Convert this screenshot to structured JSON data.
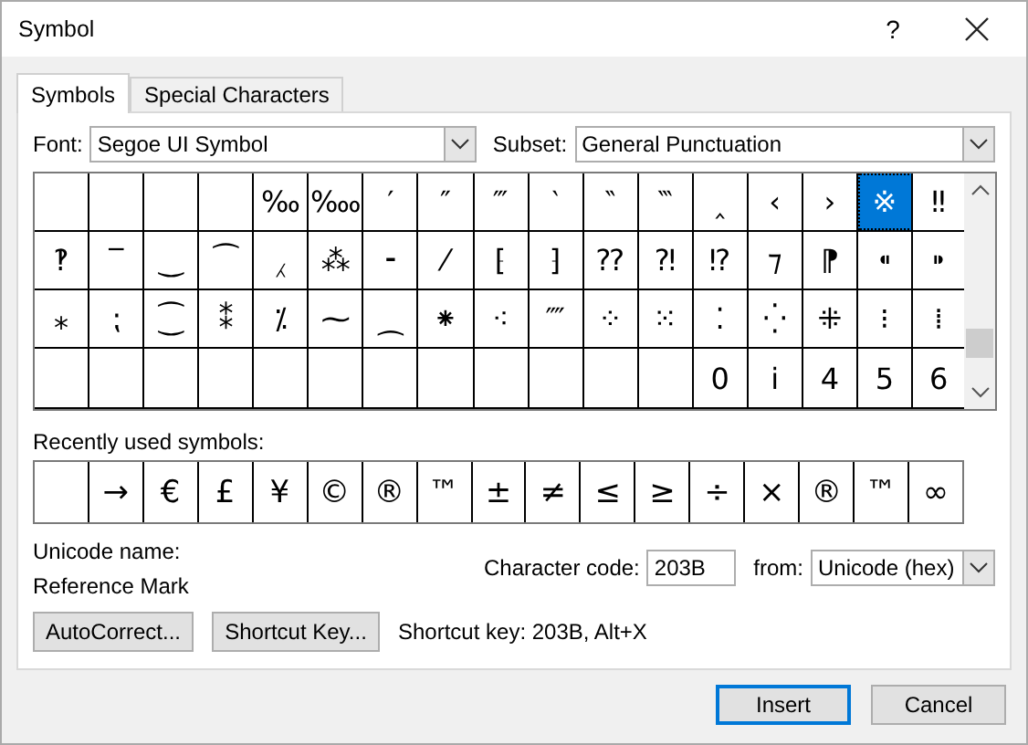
{
  "window": {
    "title": "Symbol",
    "help": "?"
  },
  "tabs": [
    {
      "label": "Symbols",
      "selected": true
    },
    {
      "label": "Special Characters",
      "selected": false
    }
  ],
  "font": {
    "label": "Font:",
    "value": "Segoe UI Symbol"
  },
  "subset": {
    "label": "Subset:",
    "value": "General Punctuation"
  },
  "grid": {
    "rows": [
      [
        {
          "selected": false
        },
        {
          "selected": false
        },
        {
          "selected": false
        },
        {
          "selected": false
        },
        {
          "symbol": "‰",
          "selected": false
        },
        {
          "symbol": "‱",
          "selected": false
        },
        {
          "symbol": "′",
          "selected": false
        },
        {
          "symbol": "″",
          "selected": false
        },
        {
          "symbol": "‴",
          "selected": false
        },
        {
          "symbol": "‵",
          "selected": false
        },
        {
          "symbol": "‶",
          "selected": false
        },
        {
          "symbol": "‷",
          "selected": false
        },
        {
          "symbol": "‸",
          "selected": false
        },
        {
          "symbol": "‹",
          "selected": false
        },
        {
          "symbol": "›",
          "selected": false
        },
        {
          "symbol": "※",
          "selected": true
        },
        {
          "symbol": "‼",
          "selected": false
        }
      ],
      [
        {
          "symbol": "‽",
          "selected": false
        },
        {
          "symbol": "‾",
          "selected": false
        },
        {
          "symbol": "‿",
          "selected": false
        },
        {
          "symbol": "⁀",
          "selected": false
        },
        {
          "symbol": "⁁",
          "selected": false
        },
        {
          "symbol": "⁂",
          "selected": false
        },
        {
          "symbol": "⁃",
          "selected": false
        },
        {
          "symbol": "⁄",
          "selected": false
        },
        {
          "symbol": "⁅",
          "selected": false
        },
        {
          "symbol": "⁆",
          "selected": false
        },
        {
          "symbol": "⁇",
          "selected": false
        },
        {
          "symbol": "⁈",
          "selected": false
        },
        {
          "symbol": "⁉",
          "selected": false
        },
        {
          "symbol": "⁊",
          "selected": false
        },
        {
          "symbol": "⁋",
          "selected": false
        },
        {
          "symbol": "⁌",
          "selected": false
        },
        {
          "symbol": "⁍",
          "selected": false
        }
      ],
      [
        {
          "symbol": "⁎",
          "selected": false
        },
        {
          "symbol": "⁏",
          "selected": false
        },
        {
          "symbol": "⁐",
          "selected": false
        },
        {
          "symbol": "⁑",
          "selected": false
        },
        {
          "symbol": "⁒",
          "selected": false
        },
        {
          "symbol": "⁓",
          "selected": false
        },
        {
          "symbol": "⁔",
          "selected": false
        },
        {
          "symbol": "⁕",
          "selected": false
        },
        {
          "symbol": "⁖",
          "selected": false
        },
        {
          "symbol": "⁗",
          "selected": false
        },
        {
          "symbol": "⁘",
          "selected": false
        },
        {
          "symbol": "⁙",
          "selected": false
        },
        {
          "symbol": "⁚",
          "selected": false
        },
        {
          "symbol": "⁛",
          "selected": false
        },
        {
          "symbol": "⁜",
          "selected": false
        },
        {
          "symbol": "⁝",
          "selected": false
        },
        {
          "symbol": "⁞",
          "selected": false
        }
      ],
      [
        {
          "selected": false
        },
        {
          "selected": false
        },
        {
          "selected": false
        },
        {
          "selected": false
        },
        {
          "selected": false
        },
        {
          "selected": false
        },
        {
          "selected": false
        },
        {
          "selected": false
        },
        {
          "selected": false
        },
        {
          "selected": false
        },
        {
          "selected": false
        },
        {
          "selected": false
        },
        {
          "symbol": "0",
          "selected": false
        },
        {
          "symbol": "i",
          "selected": false
        },
        {
          "symbol": "4",
          "selected": false
        },
        {
          "symbol": "5",
          "selected": false
        },
        {
          "symbol": "6",
          "selected": false
        }
      ]
    ]
  },
  "recent": {
    "label": "Recently used symbols:",
    "symbols": [
      {
        "symbol": "→"
      },
      {
        "symbol": "€"
      },
      {
        "symbol": "£"
      },
      {
        "symbol": "¥"
      },
      {
        "symbol": "©"
      },
      {
        "symbol": "®"
      },
      {
        "symbol": "™"
      },
      {
        "symbol": "±"
      },
      {
        "symbol": "≠"
      },
      {
        "symbol": "≤"
      },
      {
        "symbol": "≥"
      },
      {
        "symbol": "÷"
      },
      {
        "symbol": "×"
      },
      {
        "symbol": "®"
      },
      {
        "symbol": "™"
      },
      {
        "symbol": "∞"
      }
    ]
  },
  "unicode_name": {
    "label": "Unicode name:",
    "value": "Reference Mark"
  },
  "character_code": {
    "label": "Character code:",
    "value": "203B"
  },
  "from": {
    "label": "from:",
    "value": "Unicode (hex)"
  },
  "autocorrect_button": "AutoCorrect...",
  "shortcut_key_button": "Shortcut Key...",
  "shortcut_key_text": "Shortcut key: 203B, Alt+X",
  "buttons": [
    {
      "label": "Insert",
      "default": true
    },
    {
      "label": "Cancel",
      "default": false
    }
  ]
}
